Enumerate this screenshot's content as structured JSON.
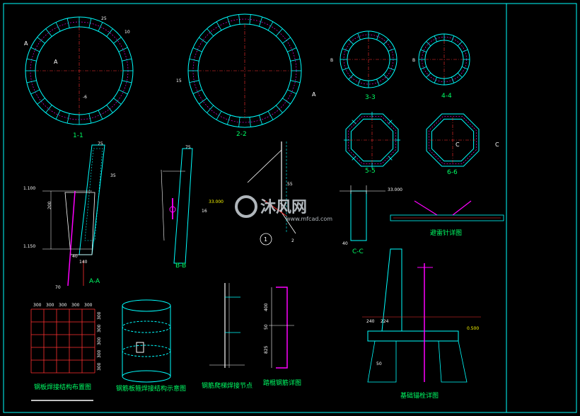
{
  "drawing": {
    "views": {
      "v1_1": "1-1",
      "v2_2": "2-2",
      "v3_3": "3-3",
      "v4_4": "4-4",
      "v5_5": "5-5",
      "v6_6": "6-6",
      "vAA": "A-A",
      "vBB": "B-B",
      "vCC": "C-C",
      "detail1": "1"
    },
    "section_markers": {
      "A": "A",
      "B": "B",
      "C": "C"
    },
    "dims": {
      "d25": "25",
      "d10": "10",
      "d6": "-6",
      "d15": "15",
      "d75": "75",
      "d35": "35",
      "d16": "16",
      "d55": "55",
      "d2": "2",
      "elev_lower": "1.100",
      "elev_upper": "1.150",
      "elev_right": "33.000",
      "elev_mid": "33.000",
      "d200": "200",
      "d140": "140",
      "d40": "40",
      "d70": "70",
      "grid_top": [
        "300",
        "300",
        "300",
        "300",
        "300"
      ],
      "grid_side": [
        "300",
        "300",
        "300",
        "300",
        "300"
      ],
      "d240": "240",
      "d224": "224",
      "d0500": "0.500",
      "d400": "400",
      "d50": "50",
      "d825": "825"
    },
    "titles": {
      "t_grid": "钢板焊接结构布置图",
      "t_cyl": "钢筋板箍焊接结构示意图",
      "t_ladder": "钢筋爬梯焊接节点",
      "t_rung": "踏棍钢筋详图",
      "t_anchor": "避雷针详图",
      "t_base": "基础锚栓详图"
    },
    "watermark": {
      "brand": "沐风网",
      "url": "www.mfcad.com"
    },
    "colors": {
      "background": "#000000",
      "concrete": "#00ffff",
      "dimension": "#ffffff",
      "label": "#ffff00",
      "title": "#00ff66",
      "rebar": "#ff00ff",
      "axis": "#ff3030",
      "frame": "#00ffff"
    }
  }
}
